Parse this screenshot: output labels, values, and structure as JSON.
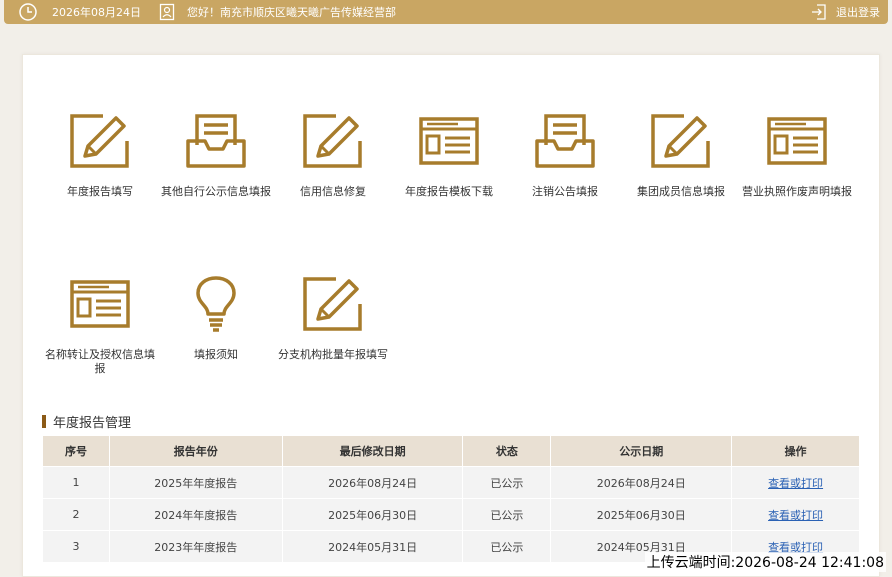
{
  "topbar": {
    "date": "2026年08月24日",
    "greeting": "您好！南充市顺庆区曦天曦广告传媒经营部",
    "logout_label": "退出登录"
  },
  "tiles": [
    {
      "label": "年度报告填写",
      "icon": "pen-edit-icon"
    },
    {
      "label": "其他自行公示信息填报",
      "icon": "inbox-tray-icon"
    },
    {
      "label": "信用信息修复",
      "icon": "pen-edit-icon"
    },
    {
      "label": "年度报告模板下载",
      "icon": "form-window-icon"
    },
    {
      "label": "注销公告填报",
      "icon": "inbox-tray-icon"
    },
    {
      "label": "集团成员信息填报",
      "icon": "pen-edit-icon"
    },
    {
      "label": "营业执照作废声明填报",
      "icon": "form-window-icon"
    },
    {
      "label": "名称转让及授权信息填报",
      "icon": "form-window-icon"
    },
    {
      "label": "填报须知",
      "icon": "lightbulb-icon"
    },
    {
      "label": "分支机构批量年报填写",
      "icon": "pen-edit-icon"
    }
  ],
  "section": {
    "title": "年度报告管理"
  },
  "table": {
    "headers": [
      "序号",
      "报告年份",
      "最后修改日期",
      "状态",
      "公示日期",
      "操作"
    ],
    "rows": [
      [
        "1",
        "2025年年度报告",
        "2026年08月24日",
        "已公示",
        "2026年08月24日",
        "查看或打印"
      ],
      [
        "2",
        "2024年年度报告",
        "2025年06月30日",
        "已公示",
        "2025年06月30日",
        "查看或打印"
      ],
      [
        "3",
        "2023年年度报告",
        "2024年05月31日",
        "已公示",
        "2024年05月31日",
        "查看或打印"
      ]
    ]
  },
  "watermark": "上传云端时间:2026-08-24 12:41:08",
  "colors": {
    "accent": "#c9a663",
    "icon": "#a77c2c",
    "link": "#2a61b4",
    "header_bg": "#e9e0d3"
  }
}
